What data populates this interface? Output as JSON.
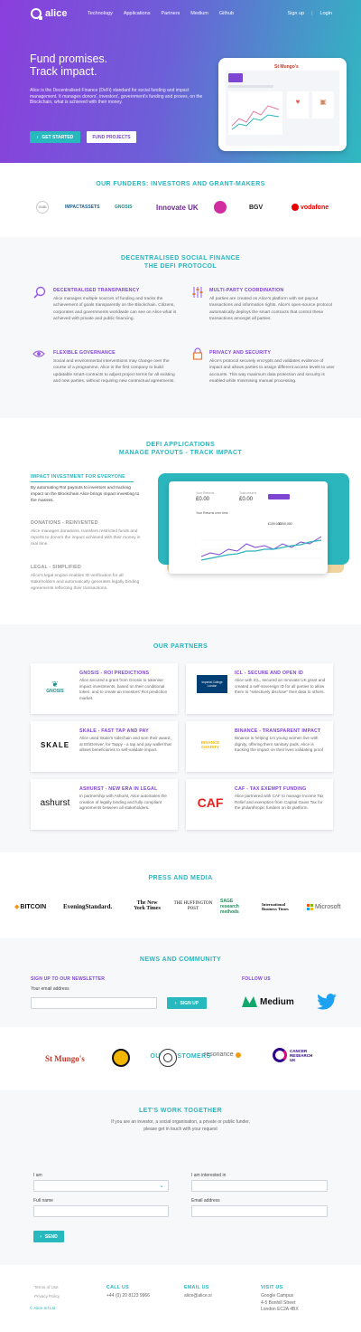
{
  "nav": {
    "logo": "alice",
    "links": [
      "Technology",
      "Applications",
      "Partners",
      "Medium",
      "Github"
    ],
    "signup": "Sign up",
    "sep": "|",
    "login": "Login"
  },
  "hero": {
    "title_line1": "Fund promises.",
    "title_line2": "Track impact.",
    "text": "Alice is the Decentralised Finance (DeFi) standard for social funding and impact management.  It manages donors', investors', government's funding and proves, on the Blockchain, what is achieved with their money.",
    "btn_started": "GET STARTED",
    "btn_fund": "FUND PROJECTS",
    "tablet_logo": "St Mungo's"
  },
  "funders": {
    "title": "OUR FUNDERS: INVESTORS AND GRANT-MAKERS",
    "logos": [
      "GABI",
      "IMPACTASSETS",
      "GNOSIS",
      "Innovate UK",
      "BGV",
      "vodafone"
    ]
  },
  "protocol": {
    "title_line1": "DECENTRALISED SOCIAL FINANCE",
    "title_line2": "THE DEFI  PROTOCOL",
    "features": [
      {
        "title": "DECENTRALISED TRANSPARENCY",
        "text": "Alice manages multiple sources of funding and tracks the achievement of goals transparently on the Blockchain. Citizens, corporates and governments worldwide can see on Alice what is achieved with private and public financing."
      },
      {
        "title": "MULTI-PARTY COORDINATION",
        "text": "All parties are created on Alice's platform with set payout transactions and information rights.  Alice's open-source protocol automatically deploys the smart contracts that control these transactions amongst all parties."
      },
      {
        "title": "FLEXIBLE GOVERNANCE",
        "text": "Social and environmental interventions may change over the course of a programme.  Alice is the first company to build updatable smart-contracts to adjust project terms for all existing and new parties, without requiring new contractual agreements."
      },
      {
        "title": "PRIVACY AND SECURITY",
        "text": "Alice's protocol securely encrypts and validates evidence of impact and allows parties to assign different access levels to user accounts. This way maximum data protection and security is enabled while minimising manual processing."
      }
    ]
  },
  "apps": {
    "title_line1": "DEFI APPLICATIONS",
    "title_line2": "MANAGE PAYOUTS - TRACK IMPACT",
    "items": [
      {
        "title": "IMPACT INVESTMENT FOR EVERYONE",
        "text": "By automating RoI payouts to investors and tracking impact on the Blockchain Alice brings impact investing to the masses."
      },
      {
        "title": "DONATIONS - REINVENTED",
        "text": "Alice manages donations, transfers restricted funds and reports to donors the impact achieved with their money in real time."
      },
      {
        "title": "LEGAL - SIMPLIFIED",
        "text": "Alice's legal engine enables ID verification for all stakeholders and automatically generates legally binding agreements reflecting their transactions."
      }
    ],
    "mock": {
      "label1": "Your Returns",
      "value1": "£0.00",
      "label2": "Total returns",
      "value2": "£0.00",
      "btn": "",
      "chart_title": "Your Returns over time",
      "value3": "£100,000",
      "value4": "£200,000"
    }
  },
  "partners": {
    "title": "OUR PARTNERS",
    "cards": [
      {
        "title": "GNOSIS - ROI PREDICTIONS",
        "text": "Alice secured a grant from Gnosis to tokenise impact investments, based on their conditional token, and to create an investors' RoI prediction market.",
        "logo": "GNOSIS"
      },
      {
        "title": "ICL - SECURE AND OPEN ID",
        "text": "Alice with ICL, secured an Innovate UK grant and created a self-sovereign ID for all parties to allow them to \"selectively disclose\" their data to others.",
        "logo": "Imperial College London"
      },
      {
        "title": "SKALE - FAST TAP AND PAY",
        "text": "Alice used Skale's sidechain and won their award, at EthDenver, for Tappy - a tap and pay wallet that allows beneficiaries to self-validate impact.",
        "logo": "SKALE"
      },
      {
        "title": "BINANCE - TRANSPARENT IMPACT",
        "text": "Binance is helping 1m young women live with dignity, offering them sanitary pads. Alice is tracking the impact on their lives validating proof",
        "logo": "BINANCE CHARITY"
      },
      {
        "title": "ASHURST - NEW ERA IN LEGAL",
        "text": "In partnership with Ashurst, Alice automates the creation of legally binding and fully compliant agreements between all stakeholders.",
        "logo": "ashurst"
      },
      {
        "title": "CAF - TAX EXEMPT FUNDING",
        "text": "Alice partnered with CAF to manage Income Tax Relief and exemption from Capital Gains Tax for the philanthropic funders on its platform.",
        "logo": "CAF"
      }
    ]
  },
  "press": {
    "title": "PRESS AND MEDIA",
    "logos": [
      "BITCOIN",
      "EveningStandard.",
      "The New York Times",
      "THE HUFFINGTON POST",
      "SAGE research methods",
      "International Business Times",
      "Microsoft"
    ]
  },
  "news": {
    "title": "NEWS AND COMMUNITY",
    "signup_title": "SIGN UP TO OUR NEWSLETTER",
    "email_label": "Your email address",
    "email_value": "",
    "btn": "SIGN UP",
    "follow": "FOLLOW US",
    "medium": "Medium"
  },
  "customers": {
    "title": "OUR CUSTOMERS",
    "logos": [
      "St Mungo's",
      "resonance",
      "CANCER RESEARCH UK"
    ]
  },
  "contact": {
    "title": "LET'S WORK TOGETHER",
    "sub_line1": "If you are an investor, a social organisation, a private or public funder,",
    "sub_line2": "please get in touch with your request",
    "i_am": "I am",
    "interested": "I am interested in",
    "full_name": "Full name",
    "email": "Email address",
    "send": "SEND"
  },
  "footer": {
    "links": [
      "Terms of Use",
      "Privacy Policy"
    ],
    "copyright": "© Alice Srl Ltd",
    "call_title": "CALL US",
    "phone": "+44 (0) 20 8123 9966",
    "email_title": "EMAIL US",
    "email": "alice@alice.si",
    "visit_title": "VISIT US",
    "address": [
      "Google Campus",
      "4-5 Bonhill Street",
      "London EC2A 4BX"
    ]
  },
  "colors": {
    "purple": "#7d45d2",
    "teal": "#2bb5bd",
    "hero_from": "#8a3fdc",
    "hero_to": "#2fb9c0"
  }
}
